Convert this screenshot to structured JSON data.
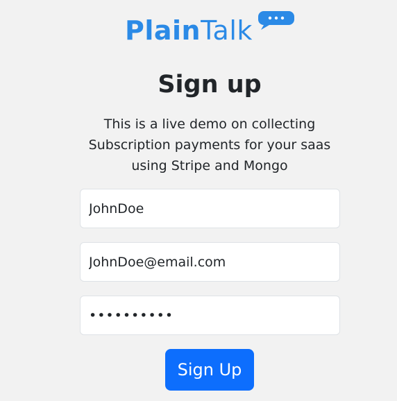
{
  "brand": {
    "name_part1": "Plain",
    "name_part2": "Talk",
    "color": "#2b8ae6",
    "icon": "chat-bubble-icon"
  },
  "heading": {
    "title": "Sign up",
    "description": "This is a live demo on collecting Subscription payments for your saas using Stripe and Mongo"
  },
  "form": {
    "username_value": "JohnDoe",
    "email_value": "JohnDoe@email.com",
    "password_value": "1234567890",
    "submit_label": "Sign Up"
  },
  "colors": {
    "background": "#f2f2f2",
    "primary_button": "#0d6efd",
    "text": "#212529"
  }
}
